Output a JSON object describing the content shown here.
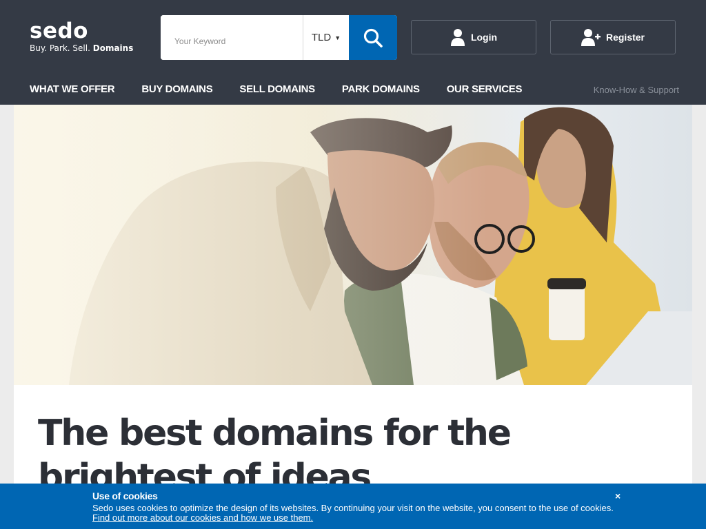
{
  "header": {
    "logo_name": "sedo",
    "logo_tagline": "Buy. Park. Sell.",
    "logo_tagline_bold": "Domains",
    "search": {
      "placeholder": "Your Keyword",
      "tld_label": "TLD"
    },
    "login_label": "Login",
    "register_label": "Register",
    "nav": [
      {
        "label": "WHAT WE OFFER"
      },
      {
        "label": "BUY DOMAINS"
      },
      {
        "label": "SELL DOMAINS"
      },
      {
        "label": "PARK DOMAINS"
      },
      {
        "label": "OUR SERVICES"
      }
    ],
    "support_label": "Know-How & Support"
  },
  "hero": {
    "headline": "The best domains for the brightest of ideas"
  },
  "cookie": {
    "title": "Use of cookies",
    "text": "Sedo uses cookies to optimize the design of its websites. By continuing your visit on the website, you consent to the use of cookies.",
    "link": "Find out more about our cookies and how we use them.",
    "close": "×"
  },
  "colors": {
    "header_bg": "#343a45",
    "accent_blue": "#0066b3",
    "headline_text": "#2c2f36"
  },
  "icons": [
    "search-icon",
    "tld-dropdown-icon",
    "user-icon",
    "user-add-icon",
    "close-icon"
  ]
}
